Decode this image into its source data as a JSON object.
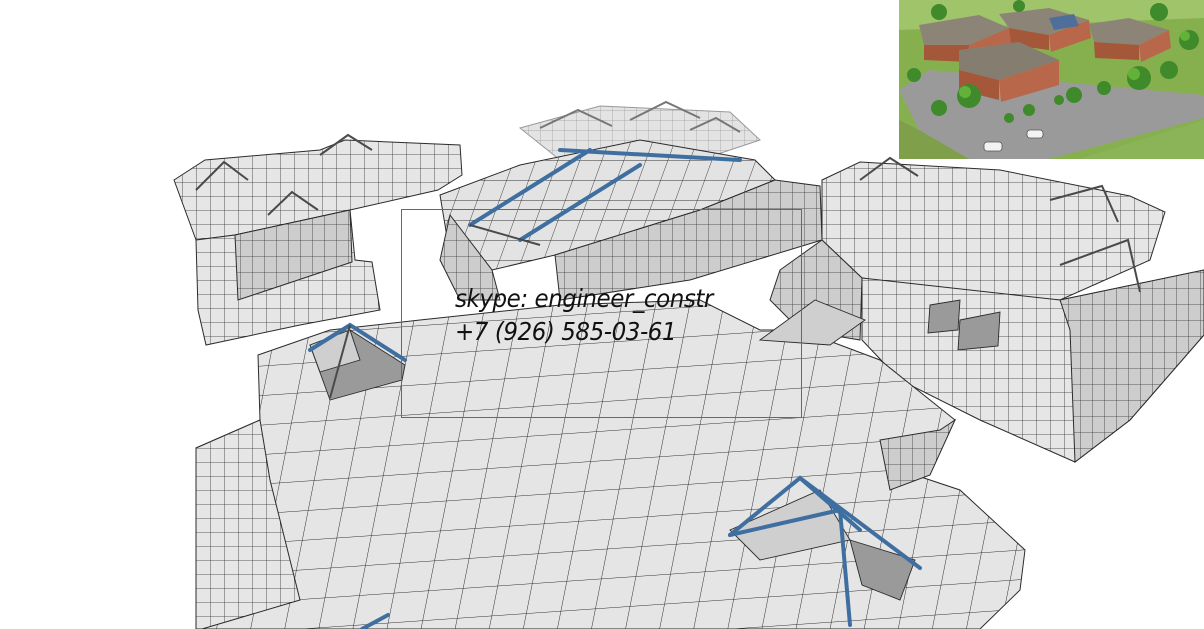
{
  "viewport": {
    "background": "#ffffff",
    "mesh_color": "#2b2b2b",
    "beam_color": "#3f6fa0",
    "selection_color": "#d23b3b"
  },
  "contact": {
    "skype": "skype: engineer_constr",
    "phone": "+7 (926) 585-03-61"
  },
  "preview": {
    "icon": "building-render-thumbnail"
  }
}
